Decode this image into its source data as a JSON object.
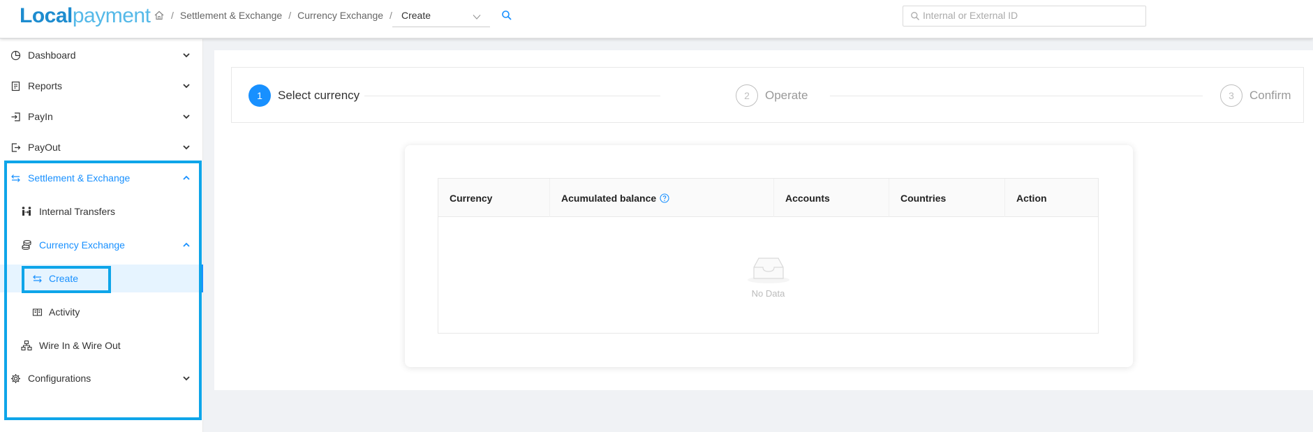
{
  "header": {
    "logo_part1": "Local",
    "logo_part2": "payment",
    "breadcrumb": [
      "Settlement & Exchange",
      "Currency Exchange"
    ],
    "crumb_select_value": "Create",
    "search_placeholder": "Internal or External ID"
  },
  "sidebar": {
    "items": [
      {
        "label": "Dashboard",
        "icon": "pie-chart-icon"
      },
      {
        "label": "Reports",
        "icon": "report-icon"
      },
      {
        "label": "PayIn",
        "icon": "login-icon"
      },
      {
        "label": "PayOut",
        "icon": "logout-icon"
      },
      {
        "label": "Settlement & Exchange",
        "icon": "swap-icon"
      },
      {
        "label": "Internal Transfers",
        "icon": "transfer-people-icon"
      },
      {
        "label": "Currency Exchange",
        "icon": "coins-icon"
      },
      {
        "label": "Create",
        "icon": "swap-icon"
      },
      {
        "label": "Activity",
        "icon": "book-icon"
      },
      {
        "label": "Wire In & Wire Out",
        "icon": "network-icon"
      },
      {
        "label": "Configurations",
        "icon": "gear-icon"
      }
    ]
  },
  "steps": [
    {
      "number": "1",
      "label": "Select currency",
      "state": "active"
    },
    {
      "number": "2",
      "label": "Operate",
      "state": "idle"
    },
    {
      "number": "3",
      "label": "Confirm",
      "state": "idle"
    }
  ],
  "table": {
    "columns": [
      "Currency",
      "Acumulated balance",
      "Accounts",
      "Countries",
      "Action"
    ],
    "empty_text": "No Data"
  },
  "colors": {
    "accent": "#1890ff",
    "highlight": "#0ea5e9",
    "logo_dark": "#1d8ccf",
    "logo_light": "#55b9e8"
  }
}
